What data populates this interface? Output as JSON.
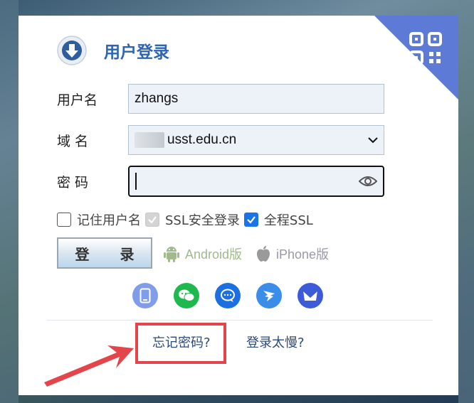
{
  "header": {
    "title": "用户登录"
  },
  "form": {
    "username_label": "用户名",
    "username_value": "zhangs",
    "domain_label": "域 名",
    "domain_value": "usst.edu.cn",
    "password_label": "密 码",
    "password_value": ""
  },
  "options": [
    {
      "label": "记住用户名",
      "state": "unchecked"
    },
    {
      "label": "SSL安全登录",
      "state": "checked-disabled"
    },
    {
      "label": "全程SSL",
      "state": "checked"
    }
  ],
  "login_button": "登 录",
  "apps": {
    "android": "Android版",
    "iphone": "iPhone版"
  },
  "social_icons": [
    "phone-icon",
    "wechat-icon",
    "qq-mail-icon",
    "dingtalk-icon",
    "lark-icon"
  ],
  "links": {
    "forgot_password": "忘记密码?",
    "login_slow": "登录太慢?"
  },
  "colors": {
    "title": "#2d64b4",
    "qr_corner": "#5d7bd6",
    "highlight_box": "#e3454a",
    "checkbox_checked": "#1a73e8",
    "app_link": "#9fba8b"
  }
}
